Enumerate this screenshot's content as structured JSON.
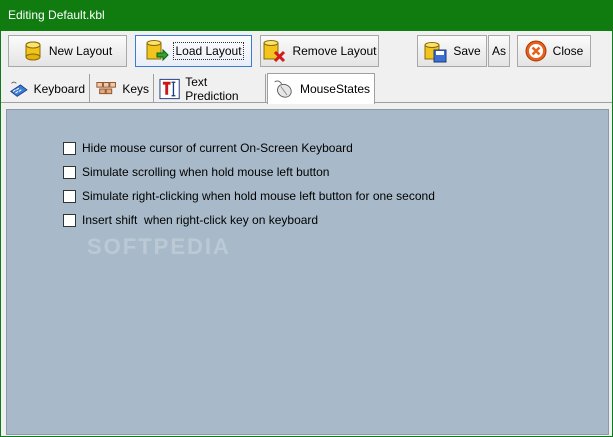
{
  "window": {
    "title": "Editing Default.kbl"
  },
  "toolbar": {
    "new_layout": "New Layout",
    "load_layout": "Load Layout",
    "remove_layout": "Remove Layout",
    "save": "Save",
    "save_as": "As",
    "close": "Close"
  },
  "tabs": [
    {
      "label": "Keyboard",
      "icon": "keyboard-icon"
    },
    {
      "label": "Keys",
      "icon": "keys-icon"
    },
    {
      "label": "Text Prediction",
      "icon": "text-prediction-icon"
    },
    {
      "label": "MouseStates",
      "icon": "mouse-icon",
      "selected": true
    }
  ],
  "options": [
    {
      "label": "Hide mouse cursor of current On-Screen Keyboard",
      "checked": false
    },
    {
      "label": "Simulate scrolling when hold mouse left button",
      "checked": false
    },
    {
      "label": "Simulate right-clicking when hold mouse left button for one second",
      "checked": false
    },
    {
      "label": "Insert shift  when right-click key on keyboard",
      "checked": false
    }
  ],
  "watermark": "SOFTPEDIA",
  "colors": {
    "titlebar": "#107c10",
    "panel": "#a8bac9",
    "close_accent": "#e8601c"
  }
}
